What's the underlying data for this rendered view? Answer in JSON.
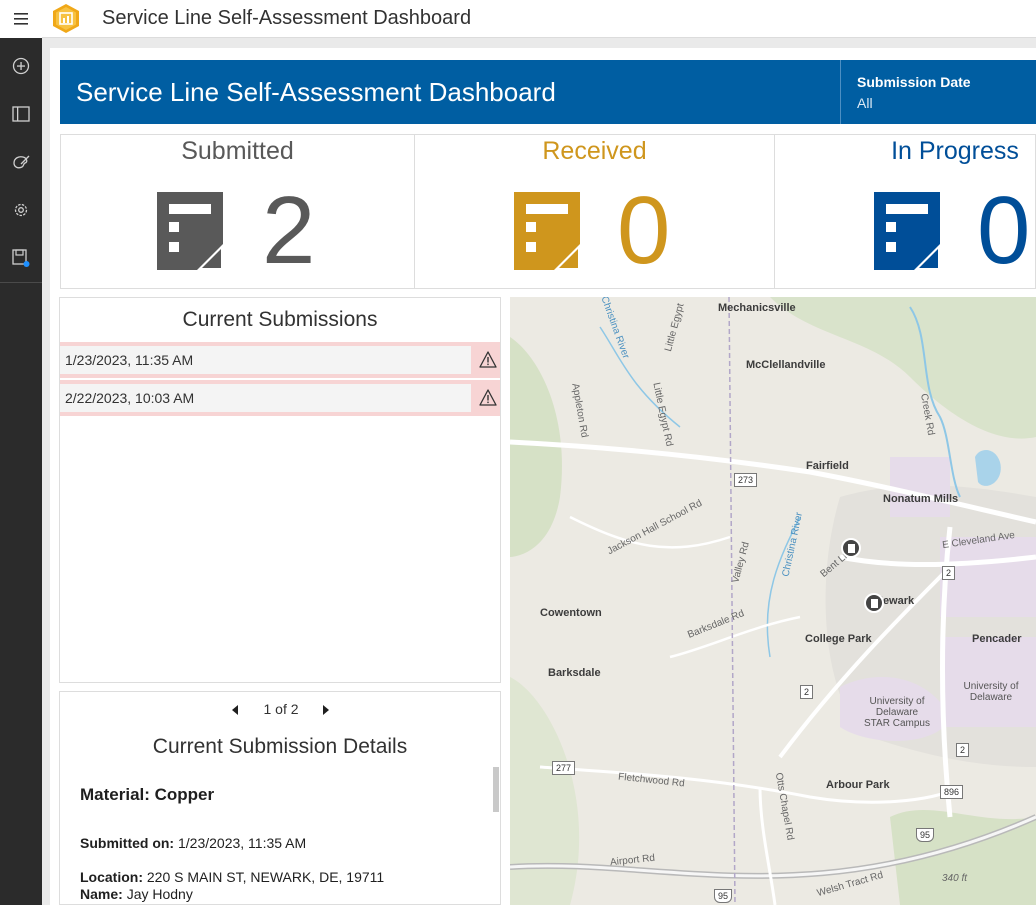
{
  "app": {
    "title": "Service Line Self-Assessment Dashboard"
  },
  "banner": {
    "title": "Service Line Self-Assessment Dashboard",
    "filter_label": "Submission Date",
    "filter_value": "All"
  },
  "indicators": [
    {
      "title": "Submitted",
      "value": "2",
      "color": "#595959"
    },
    {
      "title": "Received",
      "value": "0",
      "color": "#cf961d"
    },
    {
      "title": "In Progress",
      "value": "0",
      "color": "#004e98"
    }
  ],
  "submissions": {
    "title": "Current Submissions",
    "items": [
      {
        "label": "1/23/2023, 11:35 AM",
        "icon": "warning-icon"
      },
      {
        "label": "2/22/2023, 10:03 AM",
        "icon": "warning-icon"
      }
    ]
  },
  "details": {
    "pager_text": "1 of 2",
    "title": "Current Submission Details",
    "material": "Material: Copper",
    "submitted_label": "Submitted on:",
    "submitted_value": "1/23/2023, 11:35 AM",
    "location_label": "Location:",
    "location_value": "220 S MAIN ST, NEWARK, DE, 19711",
    "name_label": "Name:",
    "name_value": "Jay Hodny"
  },
  "map": {
    "places": [
      "Mechanicsville",
      "McClellandville",
      "Fairfield",
      "Nonatum Mills",
      "Newark",
      "Cowentown",
      "College Park",
      "Pencader",
      "Barksdale",
      "Arbour Park"
    ],
    "campuses": [
      "University of Delaware STAR Campus",
      "University of Delaware"
    ],
    "roads": [
      "Appleton Rd",
      "Little Egypt",
      "Little Egypt Rd",
      "Christina River",
      "Creek Rd",
      "Jackson Hall School Rd",
      "Valley Rd",
      "Christina River",
      "Bent Ln",
      "E Cleveland Ave",
      "Barksdale Rd",
      "Fletchwood Rd",
      "Otts Chapel Rd",
      "Airport Rd",
      "Welsh Tract Rd"
    ],
    "shields": [
      "273",
      "2",
      "2",
      "2",
      "277",
      "896",
      "95",
      "95"
    ],
    "elevation": "340 ft"
  }
}
